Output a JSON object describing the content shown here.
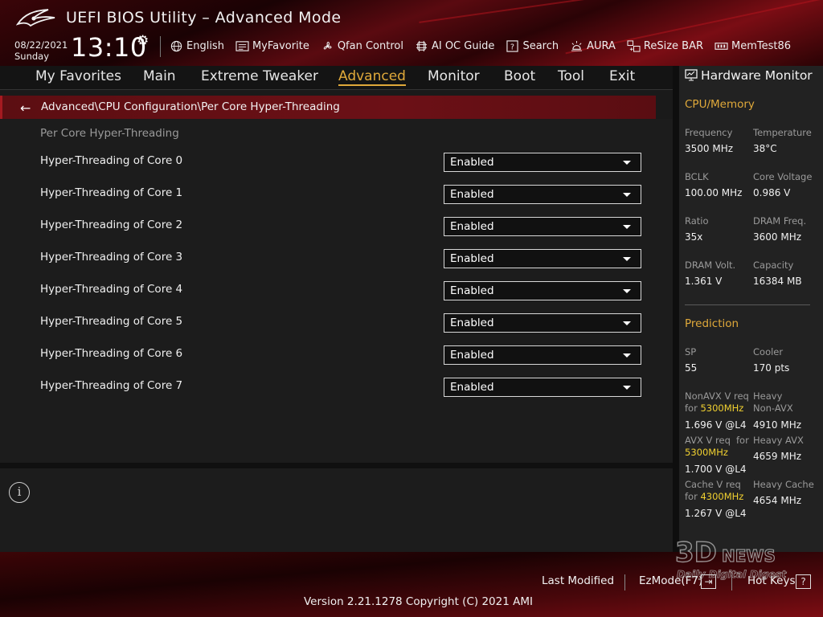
{
  "header": {
    "title": "UEFI BIOS Utility – Advanced Mode",
    "date": "08/22/2021",
    "day": "Sunday",
    "time": "13:10",
    "tools": [
      {
        "label": "English",
        "icon": "globe-icon"
      },
      {
        "label": "MyFavorite",
        "icon": "favorite-list-icon"
      },
      {
        "label": "Qfan Control",
        "icon": "fan-icon"
      },
      {
        "label": "AI OC Guide",
        "icon": "ai-chip-icon"
      },
      {
        "label": "Search",
        "icon": "search-help-icon"
      },
      {
        "label": "AURA",
        "icon": "aura-light-icon"
      },
      {
        "label": "ReSize BAR",
        "icon": "resize-bar-icon"
      },
      {
        "label": "MemTest86",
        "icon": "memory-icon"
      }
    ]
  },
  "nav": {
    "tabs": [
      "My Favorites",
      "Main",
      "Extreme Tweaker",
      "Advanced",
      "Monitor",
      "Boot",
      "Tool",
      "Exit"
    ],
    "active": "Advanced"
  },
  "breadcrumb": {
    "path": "Advanced\\CPU Configuration\\Per Core Hyper-Threading"
  },
  "content": {
    "section_heading": "Per Core Hyper-Threading",
    "settings": [
      {
        "label": "Hyper-Threading of Core 0",
        "value": "Enabled"
      },
      {
        "label": "Hyper-Threading of Core 1",
        "value": "Enabled"
      },
      {
        "label": "Hyper-Threading of Core 2",
        "value": "Enabled"
      },
      {
        "label": "Hyper-Threading of Core 3",
        "value": "Enabled"
      },
      {
        "label": "Hyper-Threading of Core 4",
        "value": "Enabled"
      },
      {
        "label": "Hyper-Threading of Core 5",
        "value": "Enabled"
      },
      {
        "label": "Hyper-Threading of Core 6",
        "value": "Enabled"
      },
      {
        "label": "Hyper-Threading of Core 7",
        "value": "Enabled"
      }
    ]
  },
  "hardware_monitor": {
    "title": "Hardware Monitor",
    "cpu_memory": {
      "heading": "CPU/Memory",
      "frequency_label": "Frequency",
      "frequency": "3500 MHz",
      "temperature_label": "Temperature",
      "temperature": "38°C",
      "bclk_label": "BCLK",
      "bclk": "100.00 MHz",
      "core_voltage_label": "Core Voltage",
      "core_voltage": "0.986 V",
      "ratio_label": "Ratio",
      "ratio": "35x",
      "dram_freq_label": "DRAM Freq.",
      "dram_freq": "3600 MHz",
      "dram_volt_label": "DRAM Volt.",
      "dram_volt": "1.361 V",
      "capacity_label": "Capacity",
      "capacity": "16384 MB"
    },
    "prediction": {
      "heading": "Prediction",
      "sp_label": "SP",
      "sp": "55",
      "cooler_label": "Cooler",
      "cooler": "170 pts",
      "nonavx_label_a": "NonAVX V req",
      "nonavx_label_b": "for",
      "nonavx_freq": "5300MHz",
      "nonavx_value": "1.696 V @L4",
      "heavy_nonavx_label_a": "Heavy",
      "heavy_nonavx_label_b": "Non-AVX",
      "heavy_nonavx_value": "4910 MHz",
      "avx_label_a": "AVX V req",
      "avx_label_b": "for",
      "avx_freq": "5300MHz",
      "avx_value": "1.700 V @L4",
      "heavy_avx_label": "Heavy AVX",
      "heavy_avx_value": "4659 MHz",
      "cache_label_a": "Cache V req",
      "cache_label_b": "for",
      "cache_freq": "4300MHz",
      "cache_value": "1.267 V @L4",
      "heavy_cache_label": "Heavy Cache",
      "heavy_cache_value": "4654 MHz"
    }
  },
  "footer": {
    "last_modified": "Last Modified",
    "ezmode": "EzMode(F7)",
    "hotkeys": "Hot Keys",
    "hotkeys_icon_char": "?",
    "version": "Version 2.21.1278 Copyright (C) 2021 AMI"
  },
  "watermark": {
    "line1": "3D",
    "line2": "NEWS",
    "line3": "Daily Digital Digest"
  },
  "colors": {
    "accent": "#e0a93a",
    "brand_red": "#a51a20",
    "highlight": "#f0d030"
  }
}
